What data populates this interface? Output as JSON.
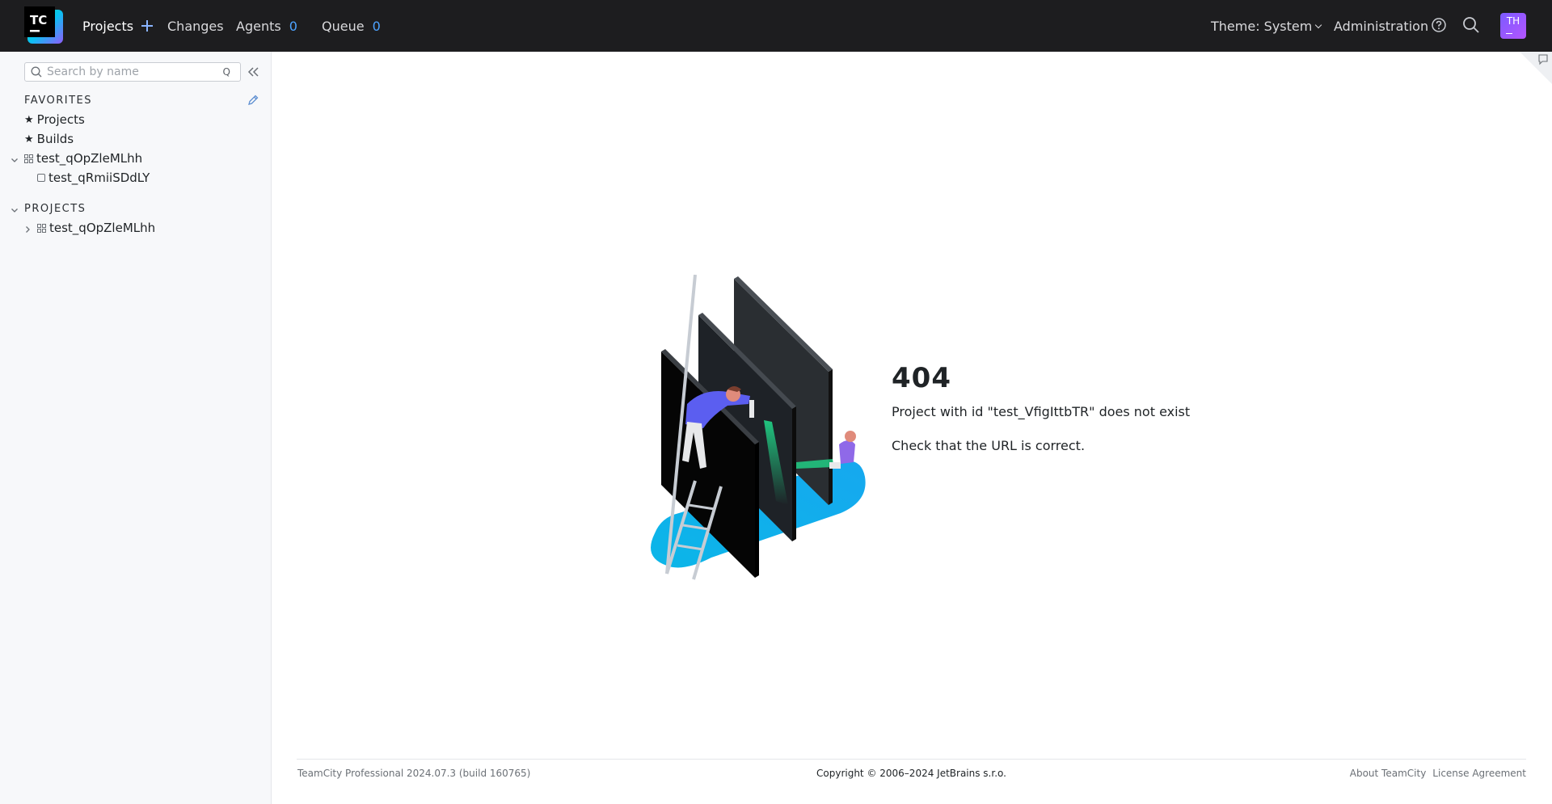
{
  "header": {
    "logo_text": "TC",
    "nav": {
      "projects": "Projects",
      "changes": "Changes",
      "agents": "Agents",
      "agents_count": "0",
      "queue": "Queue",
      "queue_count": "0"
    },
    "theme_label": "Theme: System",
    "administration": "Administration",
    "avatar_initials": "TH"
  },
  "sidebar": {
    "search_placeholder": "Search by name",
    "search_shortcut": "Q",
    "favorites_title": "FAVORITES",
    "favorites": [
      {
        "label": "Projects"
      },
      {
        "label": "Builds"
      },
      {
        "label": "test_qOpZleMLhh"
      },
      {
        "label": "test_qRmiiSDdLY"
      }
    ],
    "projects_title": "PROJECTS",
    "projects": [
      {
        "label": "test_qOpZleMLhh"
      }
    ]
  },
  "main": {
    "error_code": "404",
    "message": "Project with id \"test_VfigIttbTR\" does not exist",
    "hint": "Check that the URL is correct."
  },
  "footer": {
    "version": "TeamCity Professional 2024.07.3 (build 160765)",
    "copyright": "Copyright © 2006–2024 JetBrains s.r.o.",
    "about": "About TeamCity",
    "license": "License Agreement"
  }
}
